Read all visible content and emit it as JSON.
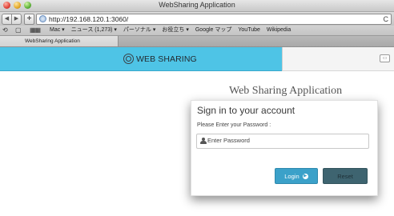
{
  "window": {
    "title": "WebSharing Application"
  },
  "toolbar": {
    "back_glyph": "◀",
    "forward_glyph": "▶",
    "new_tab_glyph": "+",
    "url": "http://192.168.120.1:3060/",
    "reload_glyph": "C"
  },
  "bookmarks": {
    "icons": [
      "reading-list-icon",
      "bookmarks-book-icon",
      "top-sites-grid-icon"
    ],
    "items": [
      {
        "label": "Mac ▾"
      },
      {
        "label": "ニュース (1,273) ▾"
      },
      {
        "label": "パーソナル ▾"
      },
      {
        "label": "お役立ち ▾"
      },
      {
        "label": "Google マップ"
      },
      {
        "label": "YouTube"
      },
      {
        "label": "Wikipedia"
      }
    ]
  },
  "tabs": [
    {
      "label": "WebSharing Application"
    }
  ],
  "page": {
    "brand": {
      "text": "WEB SHARING",
      "logo_icon": "globe-logo-icon"
    },
    "toggle_icon": "menu-toggle-icon",
    "heading": "Web Sharing Application",
    "login": {
      "title": "Sign in to your account",
      "subtitle": "Please Enter your Password :",
      "password_placeholder": "Enter Password",
      "password_value": "",
      "login_label": "Login",
      "reset_label": "Reset"
    }
  },
  "colors": {
    "navbar": "#4ec4e6",
    "login_button": "#3ba1c9",
    "reset_button": "#3e6470"
  }
}
